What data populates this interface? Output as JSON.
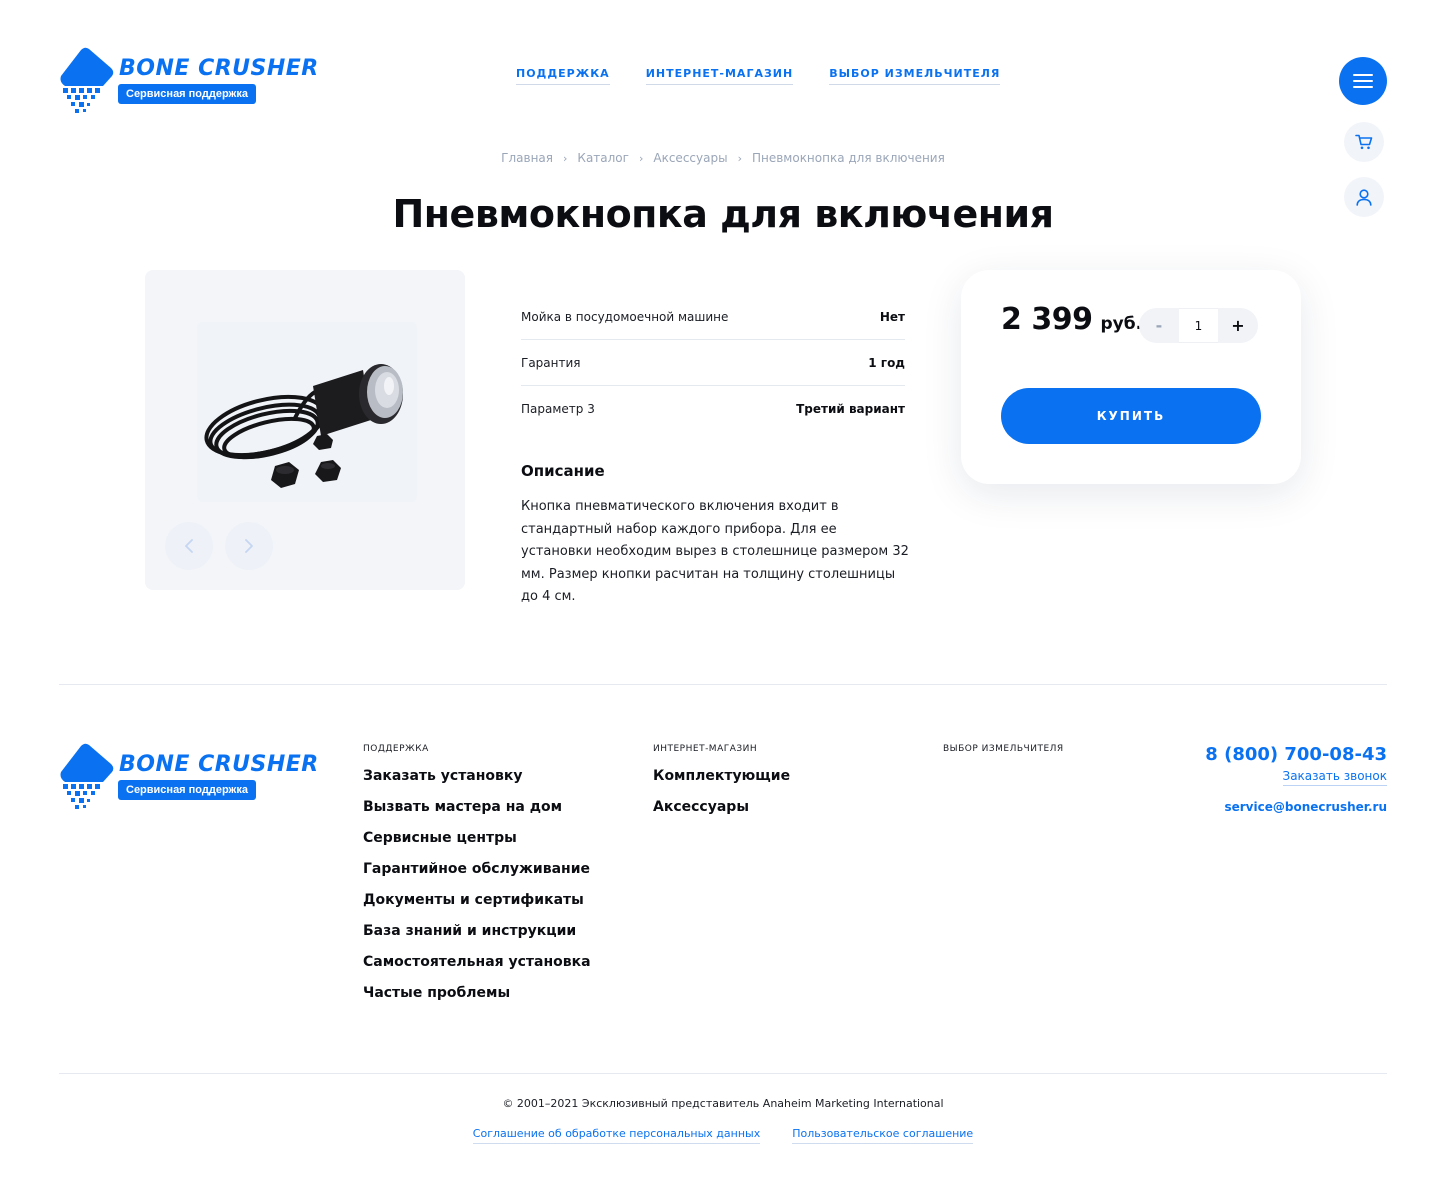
{
  "brand": {
    "name": "BONE CRUSHER",
    "tagline": "Сервисная поддержка",
    "accent_color": "#0a72f0"
  },
  "header": {
    "nav": [
      {
        "label": "ПОДДЕРЖКА"
      },
      {
        "label": "ИНТЕРНЕТ-МАГАЗИН"
      },
      {
        "label": "ВЫБОР ИЗМЕЛЬЧИТЕЛЯ"
      }
    ],
    "icons": {
      "menu": "hamburger-icon",
      "cart": "cart-icon",
      "profile": "user-icon"
    }
  },
  "breadcrumb": [
    {
      "label": "Главная"
    },
    {
      "label": "Каталог"
    },
    {
      "label": "Аксессуары"
    },
    {
      "label": "Пневмокнопка для включения"
    }
  ],
  "product": {
    "title": "Пневмокнопка для включения",
    "gallery": {
      "prev_icon": "chevron-left-icon",
      "next_icon": "chevron-right-icon"
    },
    "specs": [
      {
        "key": "Мойка в посудомоечной машине",
        "value": "Нет"
      },
      {
        "key": "Гарантия",
        "value": "1 год"
      },
      {
        "key": "Параметр 3",
        "value": "Третий вариант"
      }
    ],
    "description_title": "Описание",
    "description": "Кнопка пневматического включения входит в стандартный набор каждого прибора. Для ее установки необходим вырез в столешнице размером 32 мм. Размер кнопки расчитан на толщину столешницы до 4 см."
  },
  "buy": {
    "price": "2 399",
    "currency": "руб.",
    "qty_minus": "-",
    "qty_value": "1",
    "qty_plus": "+",
    "button": "КУПИТЬ"
  },
  "footer": {
    "columns": [
      {
        "head": "ПОДДЕРЖКА",
        "links": [
          "Заказать установку",
          "Вызвать мастера на дом",
          "Сервисные центры",
          "Гарантийное обслуживание",
          "Документы и сертификаты",
          "База знаний и инструкции",
          "Самостоятельная установка",
          "Частые проблемы"
        ]
      },
      {
        "head": "ИНТЕРНЕТ-МАГАЗИН",
        "links": [
          "Комплектующие",
          "Аксессуары"
        ]
      },
      {
        "head": "ВЫБОР ИЗМЕЛЬЧИТЕЛЯ",
        "links": []
      }
    ],
    "phone": "8 (800) 700-08-43",
    "callback": "Заказать звонок",
    "email": "service@bonecrusher.ru",
    "copyright": "© 2001–2021 Эксклюзивный представитель Anaheim Marketing International",
    "legal": [
      "Соглашение об обработке персональных данных",
      "Пользовательское соглашение"
    ]
  }
}
